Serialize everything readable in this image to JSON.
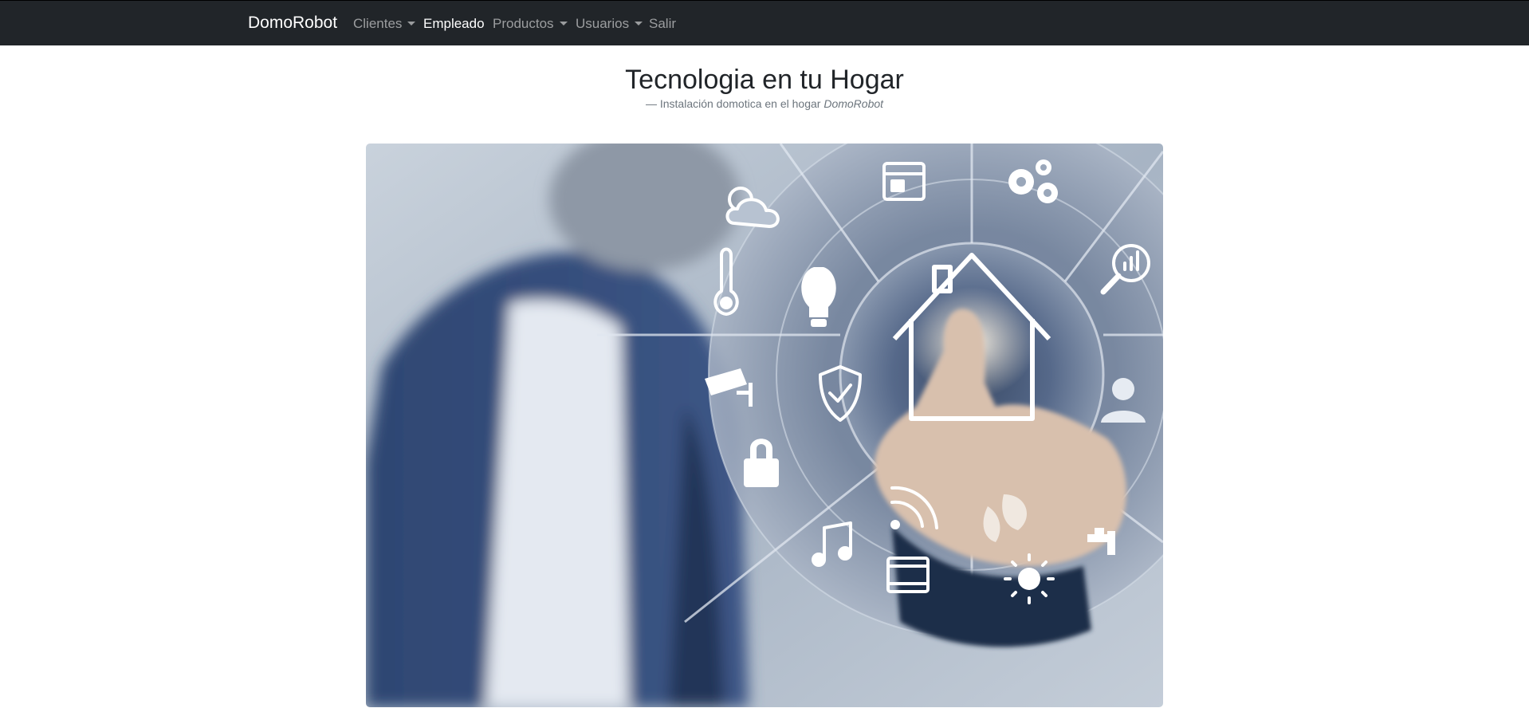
{
  "navbar": {
    "brand": "DomoRobot",
    "items": [
      {
        "label": "Clientes",
        "dropdown": true,
        "active": false
      },
      {
        "label": "Empleado",
        "dropdown": false,
        "active": true
      },
      {
        "label": "Productos",
        "dropdown": true,
        "active": false
      },
      {
        "label": "Usuarios",
        "dropdown": true,
        "active": false
      },
      {
        "label": "Salir",
        "dropdown": false,
        "active": false
      }
    ]
  },
  "hero": {
    "title": "Tecnologia en tu Hogar",
    "subtitle_dash": "—",
    "subtitle_text": "Instalación domotica en el hogar",
    "subtitle_brand": "DomoRobot"
  },
  "image": {
    "subject": "smart-home-touch-interface",
    "icons": [
      "weather-icon",
      "calendar-icon",
      "gears-icon",
      "analytics-search-icon",
      "thermometer-icon",
      "lightbulb-icon",
      "home-icon",
      "security-camera-icon",
      "shield-check-icon",
      "user-icon",
      "lock-icon",
      "wifi-icon",
      "leaf-icon",
      "faucet-icon",
      "music-icon",
      "film-icon",
      "sun-icon"
    ]
  },
  "colors": {
    "navbar_bg": "#212529",
    "nav_text": "rgba(255,255,255,0.55)",
    "nav_active": "#ffffff",
    "title": "#212529",
    "subtitle": "#6c757d"
  }
}
